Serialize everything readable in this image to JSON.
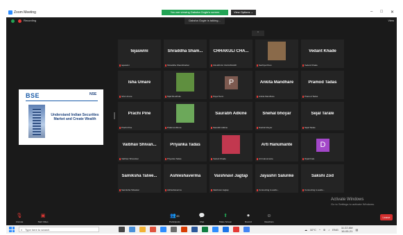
{
  "window": {
    "title": "Zoom Meeting",
    "controls": [
      "–",
      "□",
      "✕"
    ]
  },
  "banner": {
    "sharing_text": "You are viewing Daksha Gogte's screen",
    "view_options": "View Options ⌄"
  },
  "meeting": {
    "recording": "Recording",
    "view_label": "View",
    "speaking": "Daksha Gogte is talking...",
    "collapse": "⌃"
  },
  "shared_content": {
    "logo": "BSE",
    "partner_logo": "NSE",
    "title": "Understand Indian Securities Market and Create Wealth"
  },
  "participants": [
    {
      "name": "tejaswini",
      "label": "tejaswini"
    },
    {
      "name": "Shraddha Sham...",
      "label": "Shraddha Shambharkar"
    },
    {
      "name": "CHHAKULI CHA...",
      "label": "CHHAKULI CHAUDHARI"
    },
    {
      "name": "",
      "label": "Sachiya Khan",
      "photo": true,
      "photo_color": "#8a6a4a"
    },
    {
      "name": "Vedant Khade",
      "label": "Vedant Khade"
    },
    {
      "name": "Isha Umare",
      "label": "Isha Umare"
    },
    {
      "name": "",
      "label": "Nijal Mendhule",
      "photo": true,
      "photo_color": "#5f8f3f"
    },
    {
      "name": "",
      "label": "Payal Sonn",
      "letter": "P",
      "letter_color": "#7d5a50"
    },
    {
      "name": "Ankita Mandhare",
      "label": "Ankita Mandhare"
    },
    {
      "name": "Pramod Tadas",
      "label": "Pramod Tadas"
    },
    {
      "name": "Prachi Pine",
      "label": "Prachi Pine"
    },
    {
      "name": "",
      "label": "Praful ambhure",
      "photo": true,
      "photo_color": "#6ca85a"
    },
    {
      "name": "Saurabh Adkine",
      "label": "Saurabh Adkine"
    },
    {
      "name": "Snehal bhoyar",
      "label": "Snehal bhoyar"
    },
    {
      "name": "Sejal Tarale",
      "label": "Sejal Tarale"
    },
    {
      "name": "Vaibhav Shivan...",
      "label": "Vaibhav Shivankar"
    },
    {
      "name": "Priyanka Tadas",
      "label": "Priyanka Tadas"
    },
    {
      "name": "",
      "label": "Vedant Khade",
      "photo": true,
      "photo_color": "#c2384f"
    },
    {
      "name": "Arti Hanumante",
      "label": "Arti Hanumante"
    },
    {
      "name": "",
      "label": "Dipali Kale",
      "letter": "D",
      "letter_color": "#a347c9"
    },
    {
      "name": "Samiksha Talwe...",
      "label": "Samiksha Talwekar"
    },
    {
      "name": "Ashleshaverma",
      "label": "Ashleshaverma"
    },
    {
      "name": "Vaishnavi Jagtap",
      "label": "Vaishnavi Jagtap"
    },
    {
      "name": "Jayashri Salunke",
      "label": "Connecting to audio..."
    },
    {
      "name": "Sakshi Zod",
      "label": "Connecting to audio..."
    }
  ],
  "toolbar": {
    "unmute": "Unmute",
    "start_video": "Start Video",
    "participants": "Participants",
    "participants_count": "45",
    "chat": "Chat",
    "share_screen": "Share Screen",
    "record": "Record",
    "reactions": "Reactions",
    "leave": "Leave"
  },
  "watermark": {
    "title": "Activate Windows",
    "subtitle": "Go to Settings to activate Windows."
  },
  "taskbar": {
    "search_placeholder": "Type here to search",
    "weather": "32°C",
    "language": "ENG",
    "time": "11:22 AM",
    "date": "16-03-21"
  },
  "colors": {
    "accent": "#2d8cff",
    "banner_green": "#23a455",
    "leave_red": "#d32f2f",
    "tile_bg": "#242424"
  }
}
